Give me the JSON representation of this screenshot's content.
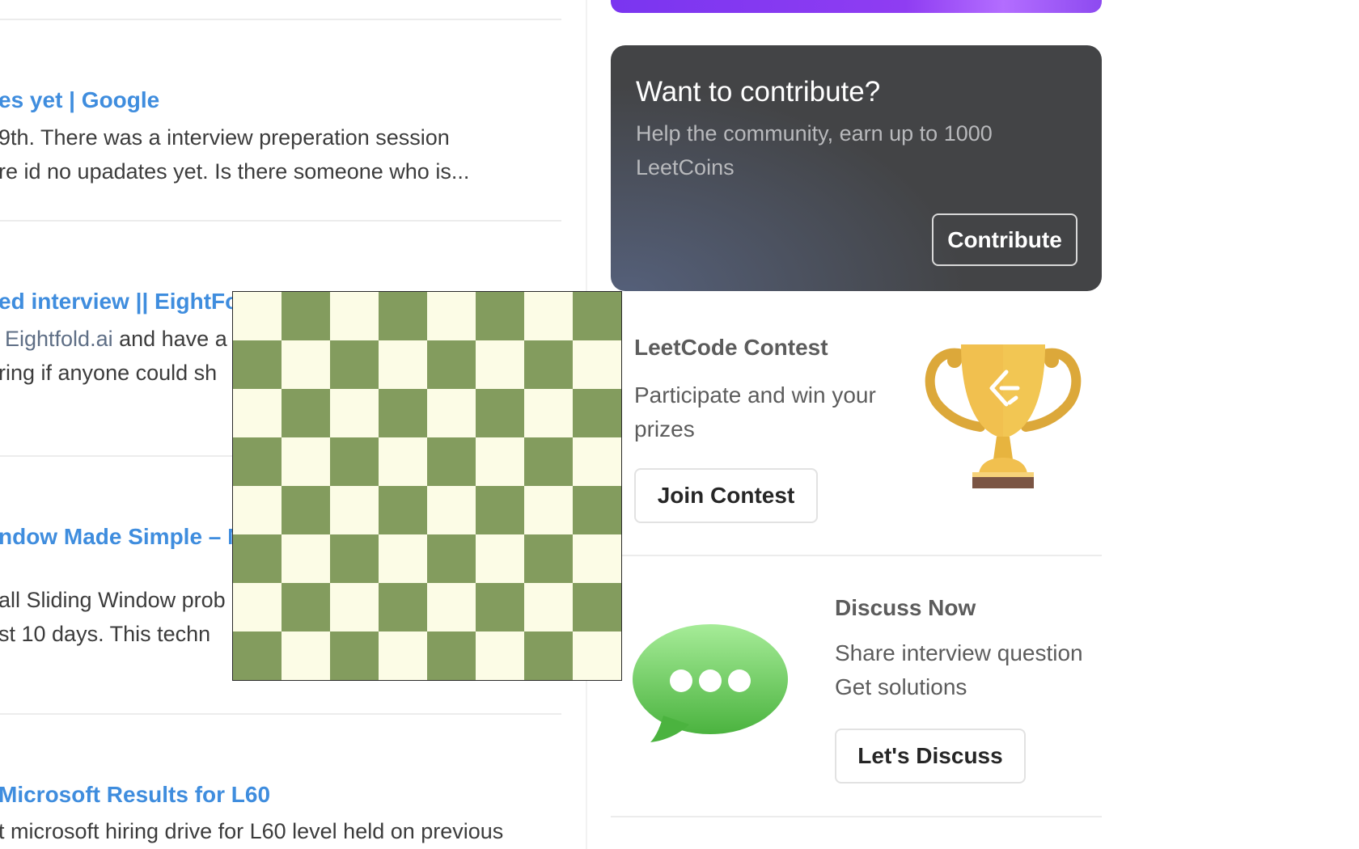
{
  "feed": {
    "posts": [
      {
        "title": "es yet | Google",
        "lines": [
          "9th. There was a interview preperation session",
          "re id no upadates yet. Is there someone who is..."
        ]
      },
      {
        "title": "ed interview || EightFol",
        "mention": "Eightfold.ai",
        "line1_rest": " and have a",
        "line2": "ring if anyone could sh"
      },
      {
        "title": "ndow Made Simple – M",
        "lines": [
          "all Sliding Window prob",
          "st 10 days. This techn"
        ]
      },
      {
        "title": "Microsoft Results for L60",
        "lines": [
          "t microsoft hiring drive for L60 level held on previous"
        ]
      }
    ]
  },
  "sidebar": {
    "contribute": {
      "title": "Want to contribute?",
      "subtitle": "Help the community, earn up to 1000 LeetCoins",
      "button": "Contribute"
    },
    "contest": {
      "title": "LeetCode Contest",
      "subtitle": "Participate and win your prizes",
      "button": "Join Contest",
      "icon": "trophy-icon"
    },
    "discuss": {
      "title": "Discuss Now",
      "line1": "Share interview question",
      "line2": "Get solutions",
      "button": "Let's Discuss",
      "icon": "chat-bubble-icon"
    }
  },
  "board": {
    "size": 8,
    "light_color": "#fcfce6",
    "dark_color": "#839c5e",
    "top_left": "light"
  },
  "colors": {
    "link": "#3f8dde",
    "contribute_card": "#434446",
    "promo_gradient_start": "#7a35f0",
    "trophy_gold": "#f1c04f",
    "chat_green": "#5dbd4c"
  }
}
